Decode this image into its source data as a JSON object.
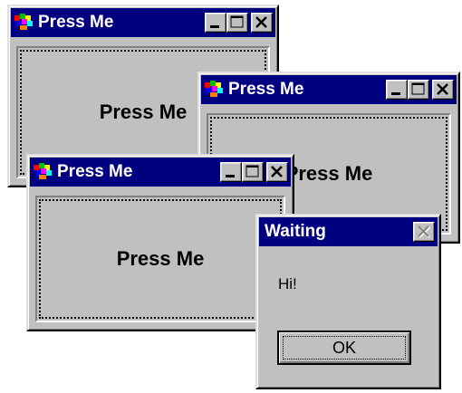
{
  "windows": [
    {
      "title": "Press Me",
      "button_label": "Press Me"
    },
    {
      "title": "Press Me",
      "button_label": "Press Me"
    },
    {
      "title": "Press Me",
      "button_label": "Press Me"
    }
  ],
  "dialog": {
    "title": "Waiting",
    "message": "Hi!",
    "ok_label": "OK"
  },
  "colors": {
    "titlebar": "#000080",
    "face": "#c0c0c0"
  },
  "icons": {
    "app": "app-icon",
    "minimize": "minimize-icon",
    "maximize": "maximize-icon",
    "close": "close-icon"
  }
}
